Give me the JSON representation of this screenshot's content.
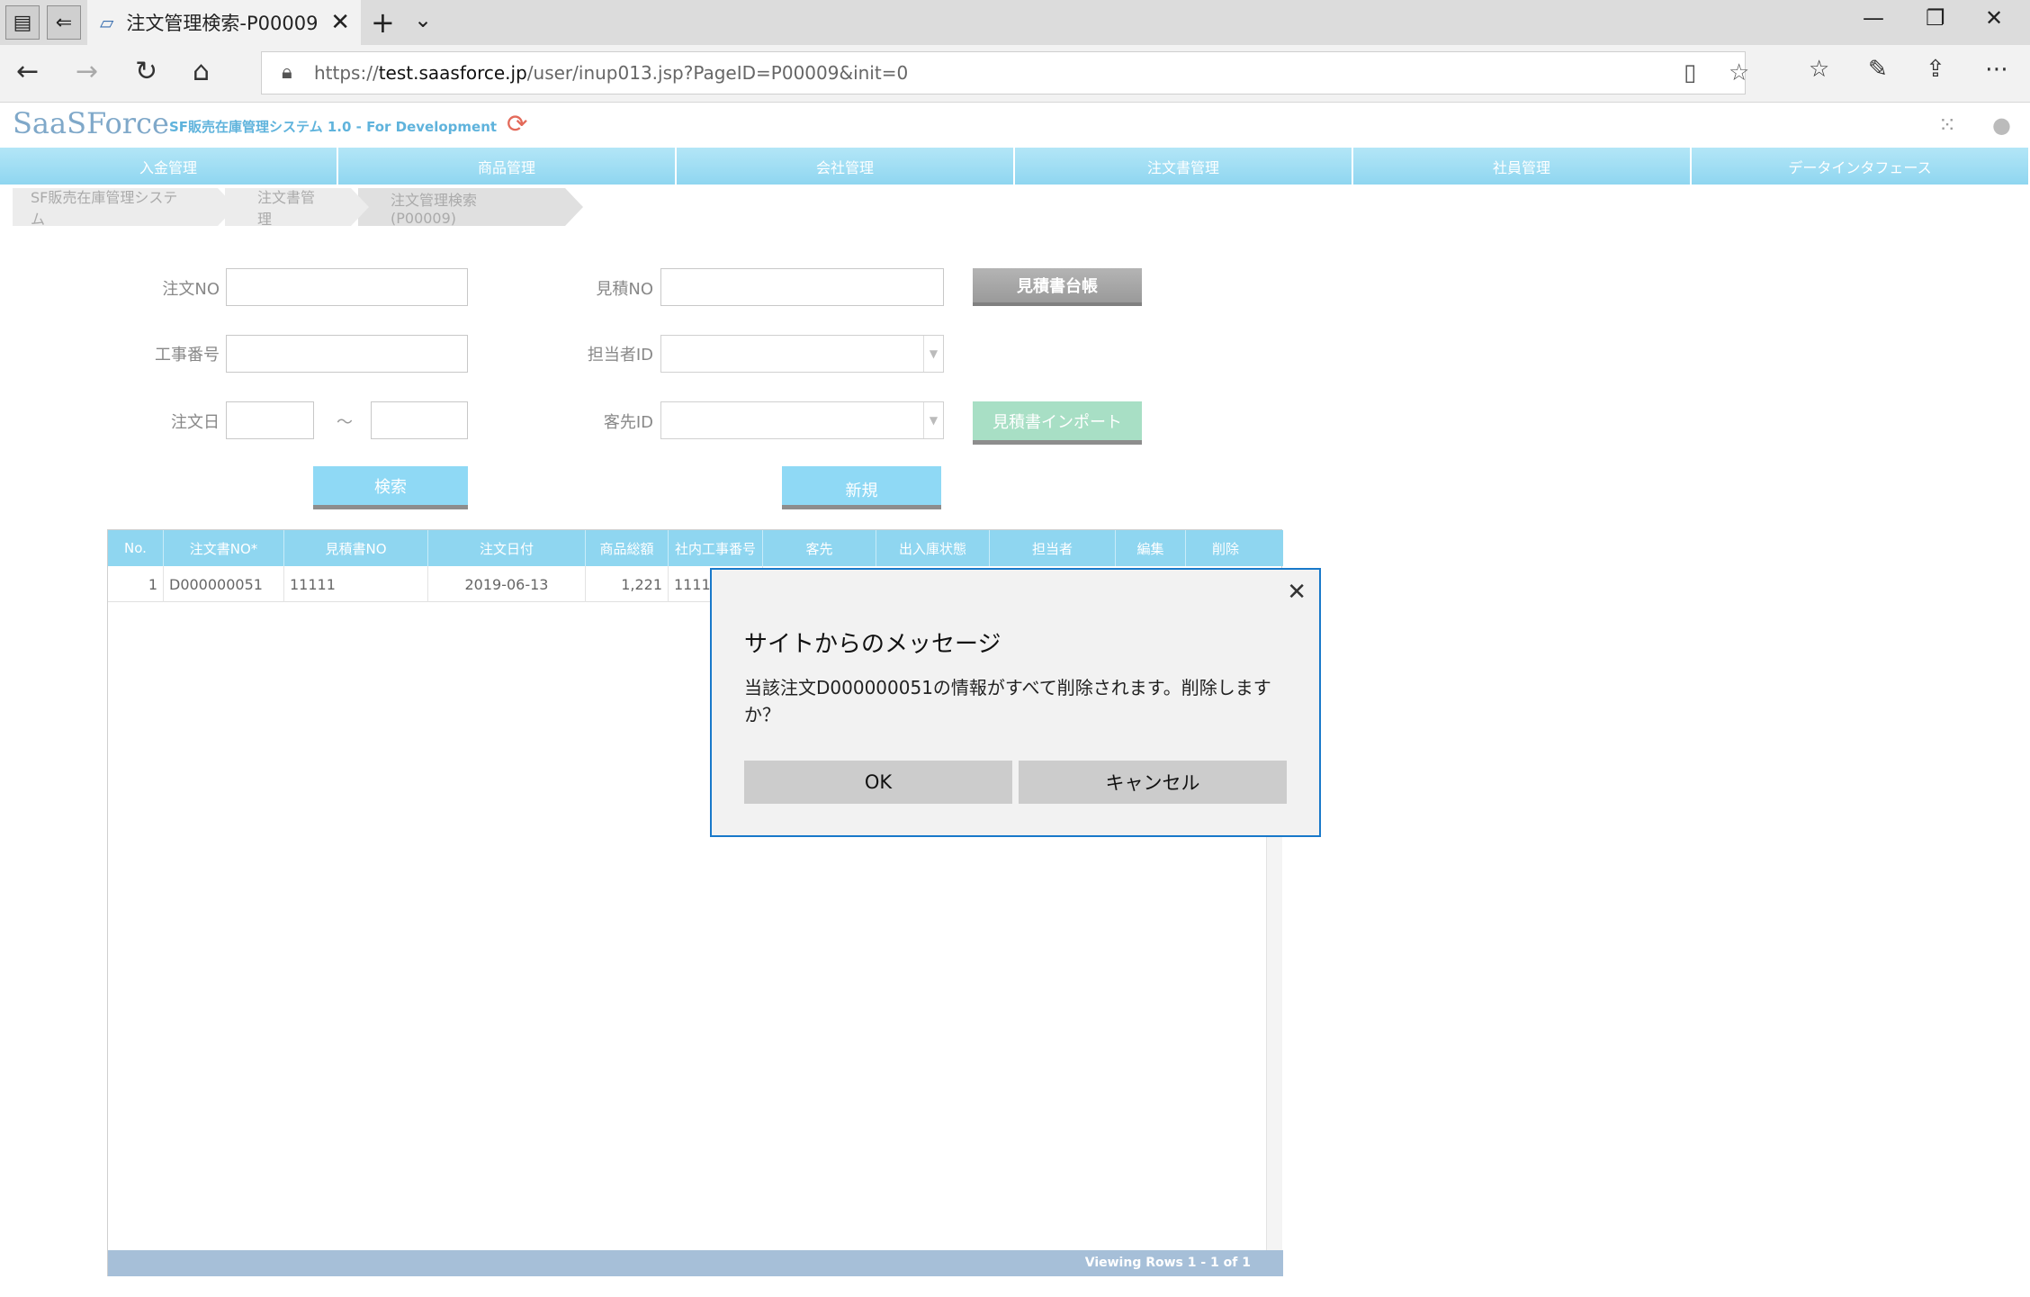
{
  "browser": {
    "tab_title": "注文管理検索-P00009",
    "url_prefix": "https://",
    "url_domain": "test.saasforce.jp",
    "url_path": "/user/inup013.jsp?PageID=P00009&init=0"
  },
  "app": {
    "logo": "SaaSForce",
    "system_name": "SF販売在庫管理システム 1.0 - For Development"
  },
  "menu": [
    "入金管理",
    "商品管理",
    "会社管理",
    "注文書管理",
    "社員管理",
    "データインタフェース"
  ],
  "breadcrumb": [
    "SF販売在庫管理システム",
    "注文書管理",
    "注文管理検索(P00009)"
  ],
  "form": {
    "order_no_label": "注文NO",
    "order_no_value": "",
    "project_no_label": "工事番号",
    "project_no_value": "",
    "order_date_label": "注文日",
    "order_date_from": "",
    "order_date_to": "",
    "date_separator": "～",
    "estimate_no_label": "見積NO",
    "estimate_no_value": "",
    "staff_id_label": "担当者ID",
    "staff_id_value": "",
    "customer_id_label": "客先ID",
    "customer_id_value": "",
    "estimate_ledger_button": "見積書台帳",
    "estimate_import_button": "見積書インポート",
    "search_button": "検索",
    "new_button": "新規"
  },
  "grid": {
    "columns": [
      "No.",
      "注文書NO*",
      "見積書NO",
      "注文日付",
      "商品総額",
      "社内工事番号",
      "客先",
      "出入庫状態",
      "担当者",
      "編集",
      "削除"
    ],
    "rows": [
      {
        "no": "1",
        "order_no": "D000000051",
        "estimate_no": "11111",
        "order_date": "2019-06-13",
        "total": "1,221",
        "internal_no": "1111"
      }
    ],
    "footer": "Viewing Rows 1 - 1 of 1"
  },
  "dialog": {
    "title": "サイトからのメッセージ",
    "message": "当該注文D000000051の情報がすべて削除されます。削除しますか？",
    "ok": "OK",
    "cancel": "キャンセル"
  }
}
